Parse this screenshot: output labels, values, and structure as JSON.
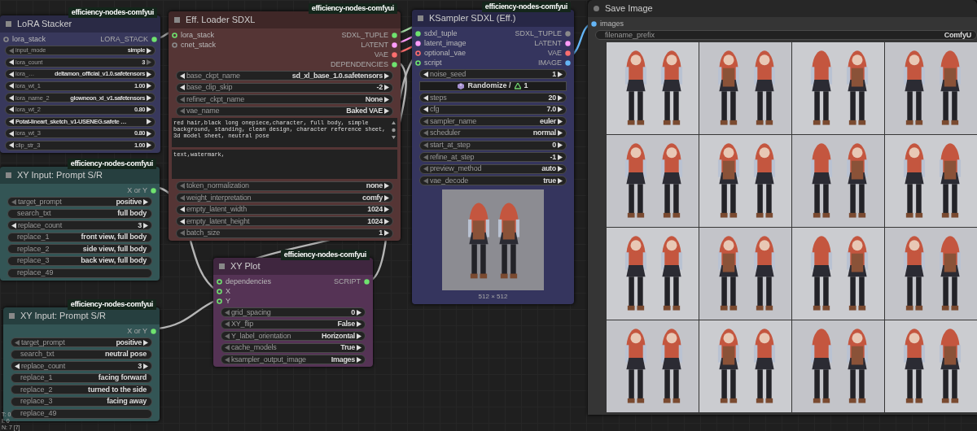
{
  "nodes": [
    {
      "kind": "standard",
      "title": "LoRA Stacker",
      "badge": "efficiency-nodes-comfyui",
      "color": "#38385c",
      "inputs": [
        {
          "label": "lora_stack",
          "color": "#8a8a8a",
          "optional": true
        }
      ],
      "outputs": [
        {
          "label": "LORA_STACK",
          "color": "#6fe36f",
          "optional": false
        }
      ],
      "widgets": [
        {
          "kind": "arrows",
          "label": "input_mode",
          "value": "simple",
          "left_enabled": false,
          "right_enabled": true
        },
        {
          "kind": "arrows",
          "label": "lora_count",
          "value": "3",
          "left_enabled": true,
          "right_enabled": false
        },
        {
          "kind": "arrows",
          "label": "lora_…",
          "value": "deltamon_official_v1.0.safetensors",
          "left_enabled": true,
          "right_enabled": true
        },
        {
          "kind": "arrows",
          "label": "lora_wt_1",
          "value": "1.00",
          "left_enabled": true,
          "right_enabled": true
        },
        {
          "kind": "arrows",
          "label": "lora_name_2",
          "value": "glowneon_xl_v1.safetensors",
          "left_enabled": true,
          "right_enabled": true
        },
        {
          "kind": "arrows",
          "label": "lora_wt_2",
          "value": "0.80",
          "left_enabled": true,
          "right_enabled": true
        },
        {
          "kind": "arrows",
          "value": "Potat-lineart_sketch_v1-USENEG.safete …",
          "left_enabled": true,
          "right_enabled": true
        },
        {
          "kind": "arrows",
          "label": "lora_wt_3",
          "value": "0.80",
          "left_enabled": true,
          "right_enabled": true
        },
        {
          "kind": "arrows",
          "label": "clip_str_3",
          "value": "1.00",
          "left_enabled": true,
          "right_enabled": true
        }
      ]
    },
    {
      "kind": "standard",
      "title": "Eff. Loader SDXL",
      "badge": "efficiency-nodes-comfyui",
      "color": "#553535",
      "inputs": [
        {
          "label": "lora_stack",
          "color": "#6fe36f",
          "optional": true
        },
        {
          "label": "cnet_stack",
          "color": "#8a8a8a",
          "optional": true
        }
      ],
      "outputs": [
        {
          "label": "SDXL_TUPLE",
          "color": "#6fe36f",
          "optional": false
        },
        {
          "label": "LATENT",
          "color": "#ff9cf9",
          "optional": false
        },
        {
          "label": "VAE",
          "color": "#ff6e6e",
          "optional": false
        },
        {
          "label": "DEPENDENCIES",
          "color": "#6fe36f",
          "optional": false
        }
      ],
      "widgets": [
        {
          "kind": "arrows",
          "label": "base_ckpt_name",
          "value": "sd_xl_base_1.0.safetensors",
          "left_enabled": true,
          "right_enabled": true
        },
        {
          "kind": "arrows",
          "label": "base_clip_skip",
          "value": "-2",
          "left_enabled": true,
          "right_enabled": true
        },
        {
          "kind": "arrows",
          "label": "refiner_ckpt_name",
          "value": "None",
          "left_enabled": false,
          "right_enabled": true
        },
        {
          "kind": "arrows",
          "label": "vae_name",
          "value": "Baked VAE",
          "left_enabled": false,
          "right_enabled": true
        },
        {
          "kind": "textarea",
          "value": "red hair,black long onepiece,character, full body, simple background, standing, clean design, character reference sheet, 3d model sheet, neutral pose",
          "scrollbar": true
        },
        {
          "kind": "textarea",
          "value": "text,watermark,",
          "scrollbar": false
        },
        {
          "kind": "arrows",
          "label": "token_normalization",
          "value": "none",
          "left_enabled": false,
          "right_enabled": true
        },
        {
          "kind": "arrows",
          "label": "weight_interpretation",
          "value": "comfy",
          "left_enabled": false,
          "right_enabled": true
        },
        {
          "kind": "arrows",
          "label": "empty_latent_width",
          "value": "1024",
          "left_enabled": true,
          "right_enabled": true
        },
        {
          "kind": "arrows",
          "label": "empty_latent_height",
          "value": "1024",
          "left_enabled": true,
          "right_enabled": true
        },
        {
          "kind": "arrows",
          "label": "batch_size",
          "value": "1",
          "left_enabled": false,
          "right_enabled": true
        }
      ]
    },
    {
      "kind": "standard",
      "title": "KSampler SDXL (Eff.)",
      "badge": "efficiency-nodes-comfyui",
      "color": "#35355e",
      "inputs": [
        {
          "label": "sdxl_tuple",
          "color": "#6fe36f",
          "optional": false
        },
        {
          "label": "latent_image",
          "color": "#ff9cf9",
          "optional": false
        },
        {
          "label": "optional_vae",
          "color": "#ff6e6e",
          "optional": true
        },
        {
          "label": "script",
          "color": "#6fe36f",
          "optional": true
        }
      ],
      "outputs": [
        {
          "label": "SDXL_TUPLE",
          "color": "#8a8a8a",
          "optional": false
        },
        {
          "label": "LATENT",
          "color": "#ff9cf9",
          "optional": false
        },
        {
          "label": "VAE",
          "color": "#ff6e6e",
          "optional": false
        },
        {
          "label": "IMAGE",
          "color": "#64b5f6",
          "optional": false
        }
      ],
      "widgets": [
        {
          "kind": "arrows",
          "label": "noise_seed",
          "value": "1",
          "left_enabled": true,
          "right_enabled": true
        },
        {
          "kind": "button",
          "label": "Randomize /",
          "value": "1"
        },
        {
          "kind": "arrows",
          "label": "steps",
          "value": "20",
          "left_enabled": true,
          "right_enabled": true
        },
        {
          "kind": "arrows",
          "label": "cfg",
          "value": "7.0",
          "left_enabled": true,
          "right_enabled": true
        },
        {
          "kind": "arrows",
          "label": "sampler_name",
          "value": "euler",
          "left_enabled": false,
          "right_enabled": true
        },
        {
          "kind": "arrows",
          "label": "scheduler",
          "value": "normal",
          "left_enabled": false,
          "right_enabled": true
        },
        {
          "kind": "arrows",
          "label": "start_at_step",
          "value": "0",
          "left_enabled": false,
          "right_enabled": true
        },
        {
          "kind": "arrows",
          "label": "refine_at_step",
          "value": "-1",
          "left_enabled": false,
          "right_enabled": true
        },
        {
          "kind": "arrows",
          "label": "preview_method",
          "value": "auto",
          "left_enabled": false,
          "right_enabled": true
        },
        {
          "kind": "arrows",
          "label": "vae_decode",
          "value": "true",
          "left_enabled": false,
          "right_enabled": true
        }
      ],
      "preview": {
        "kind": "picture",
        "caption": "512 × 512"
      }
    },
    {
      "kind": "output",
      "title": "Save Image",
      "color": "#353535",
      "inputs": [
        {
          "label": "images",
          "color": "#64b5f6",
          "optional": false
        }
      ],
      "widgets": [
        {
          "kind": "text",
          "label": "filename_prefix",
          "value": "ComfyU"
        }
      ]
    },
    {
      "kind": "standard",
      "title": "XY Input: Prompt S/R",
      "badge": "efficiency-nodes-comfyui",
      "color": "#335555",
      "outputs": [
        {
          "label": "X or Y",
          "color": "#6fe36f",
          "optional": false
        }
      ],
      "widgets": [
        {
          "kind": "arrows",
          "label": "target_prompt",
          "value": "positive",
          "left_enabled": false,
          "right_enabled": true
        },
        {
          "kind": "text",
          "label": "search_txt",
          "value": "full body"
        },
        {
          "kind": "arrows",
          "label": "replace_count",
          "value": "3",
          "left_enabled": true,
          "right_enabled": true
        },
        {
          "kind": "text",
          "label": "replace_1",
          "value": "front view, full body"
        },
        {
          "kind": "text",
          "label": "replace_2",
          "value": "side view, full body"
        },
        {
          "kind": "text",
          "label": "replace_3",
          "value": "back view, full body"
        },
        {
          "kind": "text",
          "label": "replace_49"
        }
      ]
    },
    {
      "kind": "standard",
      "title": "XY Plot",
      "badge": "efficiency-nodes-comfyui",
      "color": "#553355",
      "inputs": [
        {
          "label": "dependencies",
          "color": "#6fe36f",
          "optional": true
        },
        {
          "label": "X",
          "color": "#6fe36f",
          "optional": true
        },
        {
          "label": "Y",
          "color": "#6fe36f",
          "optional": true
        }
      ],
      "outputs": [
        {
          "label": "SCRIPT",
          "color": "#6fe36f",
          "optional": false
        }
      ],
      "widgets": [
        {
          "kind": "arrows",
          "label": "grid_spacing",
          "value": "0",
          "left_enabled": false,
          "right_enabled": true
        },
        {
          "kind": "arrows",
          "label": "XY_flip",
          "value": "False",
          "left_enabled": false,
          "right_enabled": true
        },
        {
          "kind": "arrows",
          "label": "Y_label_orientation",
          "value": "Horizontal",
          "left_enabled": false,
          "right_enabled": true
        },
        {
          "kind": "arrows",
          "label": "cache_models",
          "value": "True",
          "left_enabled": false,
          "right_enabled": true
        },
        {
          "kind": "arrows",
          "label": "ksampler_output_image",
          "value": "Images",
          "left_enabled": false,
          "right_enabled": true
        }
      ]
    },
    {
      "kind": "standard",
      "title": "XY Input: Prompt S/R",
      "badge": "efficiency-nodes-comfyui",
      "color": "#335555",
      "outputs": [
        {
          "label": "X or Y",
          "color": "#6fe36f",
          "optional": false
        }
      ],
      "widgets": [
        {
          "kind": "arrows",
          "label": "target_prompt",
          "value": "positive",
          "left_enabled": false,
          "right_enabled": true
        },
        {
          "kind": "text",
          "label": "search_txt",
          "value": "neutral pose"
        },
        {
          "kind": "arrows",
          "label": "replace_count",
          "value": "3",
          "left_enabled": true,
          "right_enabled": true
        },
        {
          "kind": "text",
          "label": "replace_1",
          "value": "facing forward"
        },
        {
          "kind": "text",
          "label": "replace_2",
          "value": "turned to the side"
        },
        {
          "kind": "text",
          "label": "replace_3",
          "value": "facing away"
        },
        {
          "kind": "text",
          "label": "replace_49"
        }
      ]
    }
  ],
  "canvas_stats": [
    "T: 0",
    "I: 0",
    "N: 7 [7]"
  ]
}
